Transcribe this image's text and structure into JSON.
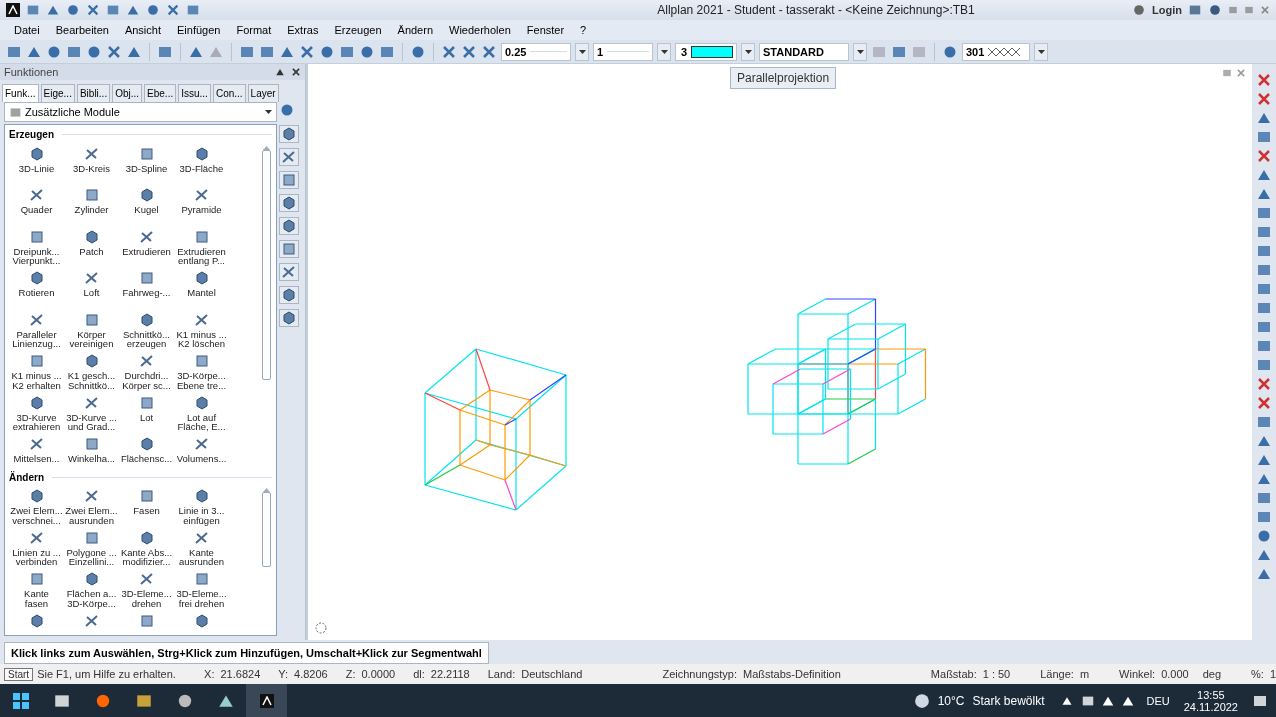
{
  "window": {
    "title": "Allplan 2021 - Student - tasserakt - <Keine Zeichnung>:TB1",
    "login": "Login"
  },
  "menu": [
    "Datei",
    "Bearbeiten",
    "Ansicht",
    "Einfügen",
    "Format",
    "Extras",
    "Erzeugen",
    "Ändern",
    "Wiederholen",
    "Fenster",
    "?"
  ],
  "toolbar": {
    "pen": "0.25",
    "line": "1",
    "color_index": "3",
    "color": "#00ffff",
    "layer": "STANDARD",
    "hatch": "301"
  },
  "panel": {
    "title": "Funktionen",
    "tabs": [
      {
        "label": "Funk...",
        "selected": true
      },
      {
        "label": "Eige...",
        "selected": false
      },
      {
        "label": "Bibli...",
        "selected": false
      },
      {
        "label": "Obj...",
        "selected": false
      },
      {
        "label": "Ebe...",
        "selected": false
      },
      {
        "label": "Issu...",
        "selected": false
      },
      {
        "label": "Con...",
        "selected": false
      },
      {
        "label": "Layer",
        "selected": false
      }
    ],
    "module": "Zusätzliche Module",
    "sections": [
      {
        "title": "Erzeugen",
        "items": [
          "3D-Linie",
          "3D-Kreis",
          "3D-Spline",
          "3D-Fläche",
          "Quader",
          "Zylinder",
          "Kugel",
          "Pyramide",
          "Dreipunk...\nVierpunkt...",
          "Patch",
          "Extrudieren",
          "Extrudieren\nentlang P...",
          "Rotieren",
          "Loft",
          "Fahrweg-...",
          "Mantel",
          "Paralleler\nLinienzug...",
          "Körper\nvereinigen",
          "Schnittkö...\nerzeugen",
          "K1 minus ...\nK2 löschen",
          "K1 minus ...\nK2 erhalten",
          "K1 gesch...\nSchnittkö...",
          "Durchdri...\nKörper sc...",
          "3D-Körpe...\nEbene tre...",
          "3D-Kurve\nextrahieren",
          "3D-Kurve ...\nund Grad...",
          "Lot",
          "Lot auf\nFläche, E...",
          "Mittelsen...",
          "Winkelha...",
          "Flächensc...",
          "Volumens..."
        ]
      },
      {
        "title": "Ändern",
        "items": [
          "Zwei Elem...\nverschnei...",
          "Zwei Elem...\nausrunden",
          "Fasen",
          "Linie in 3...\neinfügen",
          "Linien zu ...\nverbinden",
          "Polygone ...\nEinzellini...",
          "Kante Abs...\nmodifizier...",
          "Kante\nausrunden",
          "Kante\nfasen",
          "Flächen a...\n3D-Körpe...",
          "3D-Eleme...\ndrehen",
          "3D-Eleme...\nfrei drehen"
        ]
      }
    ]
  },
  "canvas": {
    "tooltip": "Parallelprojektion"
  },
  "hint": "Klick links zum Auswählen, Strg+Klick zum Hinzufügen, Umschalt+Klick zur Segmentwahl",
  "status": {
    "tooltip": "Start",
    "help": "Sie F1, um Hilfe zu erhalten.",
    "fields": [
      {
        "label": "X:",
        "value": "21.6824"
      },
      {
        "label": "Y:",
        "value": "4.8206"
      },
      {
        "label": "Z:",
        "value": "0.0000"
      },
      {
        "label": "dl:",
        "value": "22.2118"
      },
      {
        "label": "Land:",
        "value": "Deutschland"
      },
      {
        "label": "Zeichnungstyp:",
        "value": "Maßstabs-Definition"
      },
      {
        "label": "Maßstab:",
        "value": "1 : 50"
      },
      {
        "label": "Länge:",
        "value": "m"
      },
      {
        "label": "Winkel:",
        "value": "0.000"
      },
      {
        "label": "deg"
      },
      {
        "label": "%:",
        "value": "1"
      }
    ]
  },
  "taskbar": {
    "temperature": "10°C",
    "weather": "Stark bewölkt",
    "language": "DEU",
    "time": "13:55",
    "date": "24.11.2022"
  }
}
